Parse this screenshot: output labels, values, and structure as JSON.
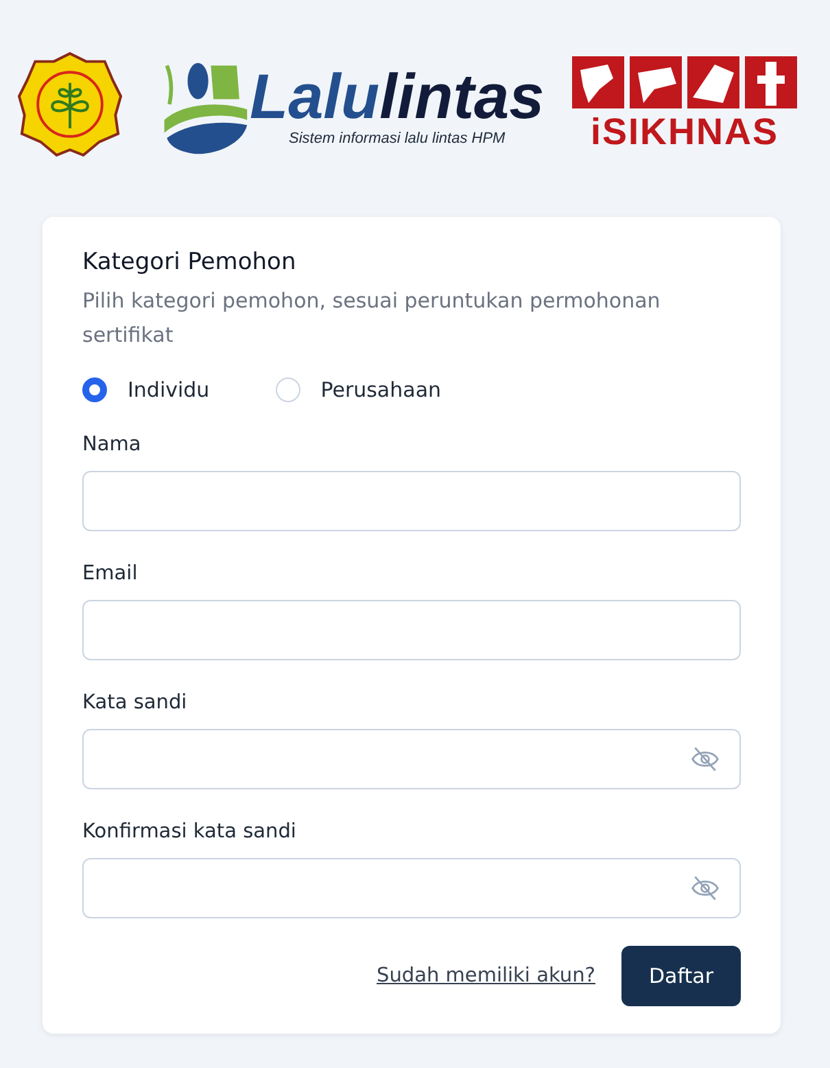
{
  "header": {
    "brand_parts": [
      "Lalu",
      "lintas"
    ],
    "tagline": "Sistem informasi lalu lintas HPM",
    "partner": "iSIKHNAS"
  },
  "form": {
    "title": "Kategori Pemohon",
    "subtitle": "Pilih kategori pemohon, sesuai peruntukan permohonan sertifikat",
    "options": [
      {
        "label": "Individu",
        "selected": true
      },
      {
        "label": "Perusahaan",
        "selected": false
      }
    ],
    "fields": [
      {
        "label": "Nama",
        "kind": "text"
      },
      {
        "label": "Email",
        "kind": "text"
      },
      {
        "label": "Kata sandi",
        "kind": "password"
      },
      {
        "label": "Konfirmasi kata sandi",
        "kind": "password"
      }
    ],
    "login_link": "Sudah memiliki akun?",
    "submit": "Daftar"
  }
}
